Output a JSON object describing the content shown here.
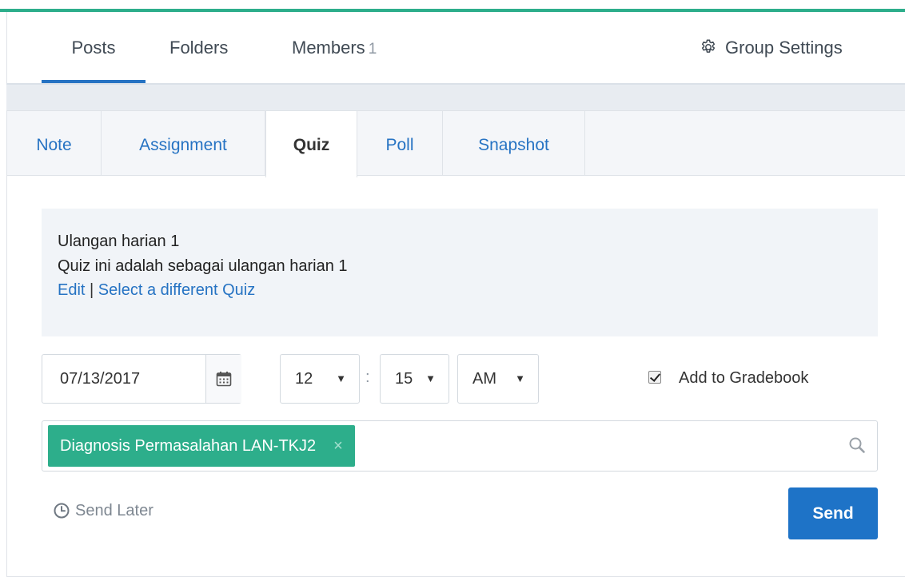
{
  "colors": {
    "accent": "#2dae8b",
    "link": "#2673c3",
    "primary_button": "#1e73c7"
  },
  "topnav": {
    "posts_label": "Posts",
    "folders_label": "Folders",
    "members_label": "Members",
    "members_count": "1",
    "group_settings_label": "Group Settings"
  },
  "post_tabs": {
    "note": "Note",
    "assignment": "Assignment",
    "quiz": "Quiz",
    "poll": "Poll",
    "snapshot": "Snapshot",
    "active": "Quiz"
  },
  "quiz": {
    "title": "Ulangan harian 1",
    "description": "Quiz ini adalah sebagai ulangan harian 1",
    "edit_link": "Edit",
    "separator": "|",
    "select_link": "Select a different Quiz"
  },
  "schedule": {
    "date": "07/13/2017",
    "hour": "12",
    "colon": ":",
    "minute": "15",
    "ampm": "AM",
    "caret": "▼"
  },
  "gradebook": {
    "label": "Add to Gradebook",
    "checked": true
  },
  "recipients": {
    "chip_label": "Diagnosis Permasalahan LAN-TKJ2",
    "remove_glyph": "×"
  },
  "actions": {
    "send_later_label": "Send Later",
    "send_label": "Send"
  },
  "icons": {
    "settings": "gear-icon",
    "calendar": "calendar-icon",
    "search": "search-icon",
    "clock": "clock-icon"
  }
}
